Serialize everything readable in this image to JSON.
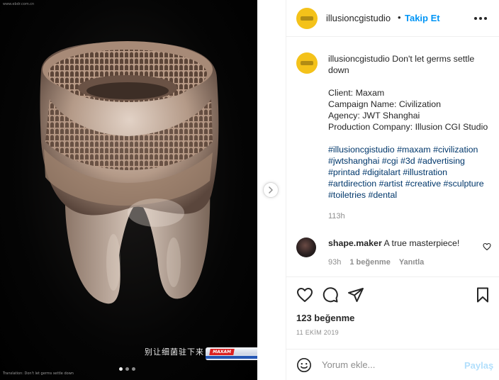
{
  "media": {
    "watermark": "www.ebdr.com.cn",
    "bottom_caption": "Translation: Don't let germs settle down",
    "chinese_text": "别让细菌驻下来",
    "product_brand": "MAXAM",
    "carousel_dots": 3,
    "active_dot": 0
  },
  "header": {
    "username": "illusioncgistudio",
    "separator": "•",
    "follow_label": "Takip Et",
    "more_icon": "more-horizontal-icon"
  },
  "caption": {
    "username": "illusioncgistudio",
    "headline": "Don't let germs settle down",
    "client": "Client: Maxam",
    "campaign": "Campaign Name: Civilization",
    "agency": "Agency: JWT Shanghai",
    "production": "Production Company: Illusion CGI Studio",
    "hashtags": "#illusioncgistudio #maxam #civilization #jwtshanghai #cgi #3d #advertising #printad #digitalart #illustration #artdirection #artist #creative #sculpture #toiletries #dental",
    "time": "113h"
  },
  "comment": {
    "username": "shape.maker",
    "text": "A true masterpiece!",
    "time": "93h",
    "likes": "1 beğenme",
    "reply": "Yanıtla"
  },
  "actions": {
    "like_icon": "heart-icon",
    "comment_icon": "comment-icon",
    "share_icon": "send-icon",
    "save_icon": "bookmark-icon"
  },
  "stats": {
    "likes": "123 beğenme",
    "date": "11 EKİM 2019"
  },
  "add_comment": {
    "placeholder": "Yorum ekle...",
    "post_label": "Paylaş"
  },
  "colors": {
    "accent": "#0095f6",
    "avatar_bg": "#f4c21a",
    "post_disabled": "#b2dffc"
  }
}
